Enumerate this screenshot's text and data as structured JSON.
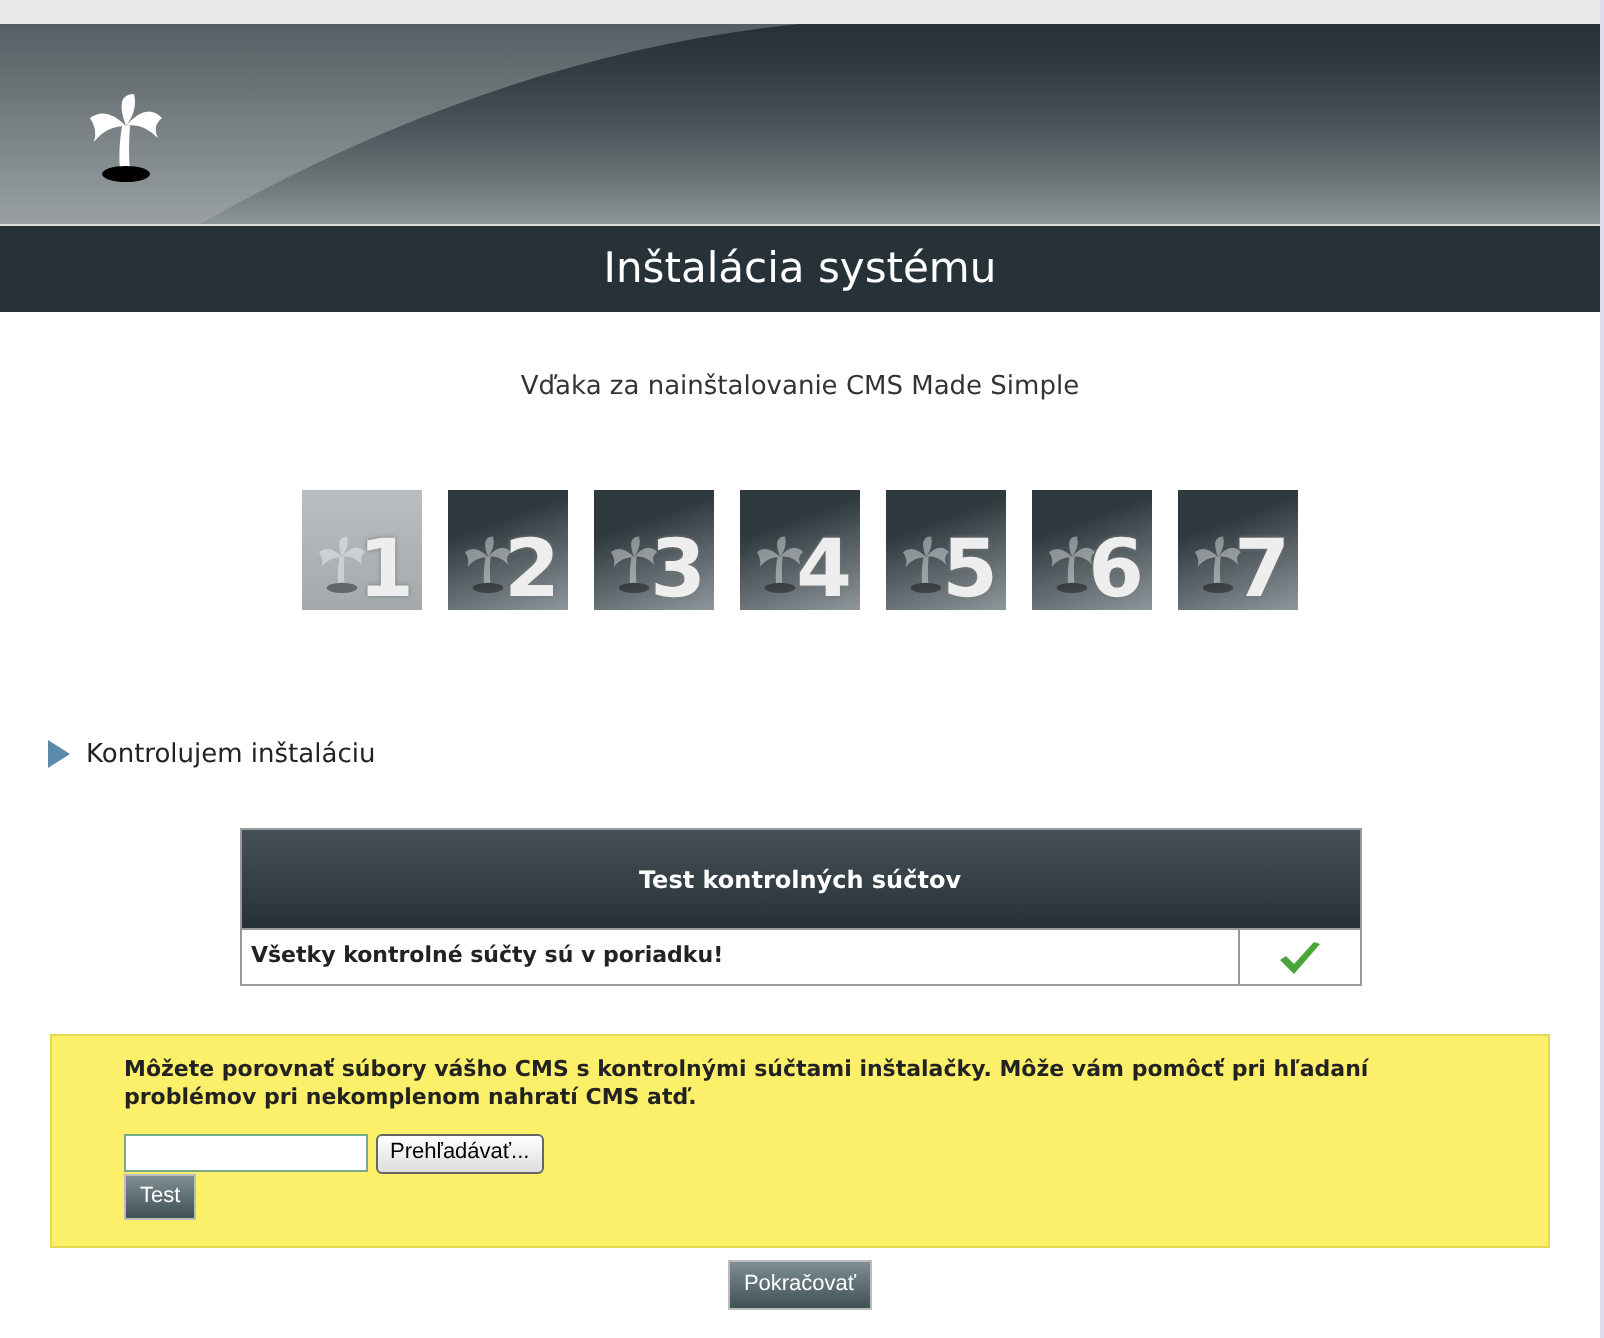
{
  "header": {
    "title": "Inštalácia systému"
  },
  "subtitle": "Vďaka za nainštalovanie CMS Made Simple",
  "steps": [
    {
      "label": "1",
      "selected": true
    },
    {
      "label": "2",
      "selected": false
    },
    {
      "label": "3",
      "selected": false
    },
    {
      "label": "4",
      "selected": false
    },
    {
      "label": "5",
      "selected": false
    },
    {
      "label": "6",
      "selected": false
    },
    {
      "label": "7",
      "selected": false
    }
  ],
  "section_title": "Kontrolujem inštaláciu",
  "checksum_table": {
    "heading": "Test kontrolných súčtov",
    "rows": [
      {
        "text": "Všetky kontrolné súčty sú v poriadku!",
        "passed": true
      }
    ]
  },
  "compare_box": {
    "text": "Môžete porovnať súbory vášho CMS s kontrolnými súčtami inštalačky. Môže vám pomôcť pri hľadaní problémov pri nekomplenom nahratí CMS atď.",
    "browse_button": "Prehľadávať...",
    "test_button": "Test"
  },
  "continue_button": "Pokračovať"
}
